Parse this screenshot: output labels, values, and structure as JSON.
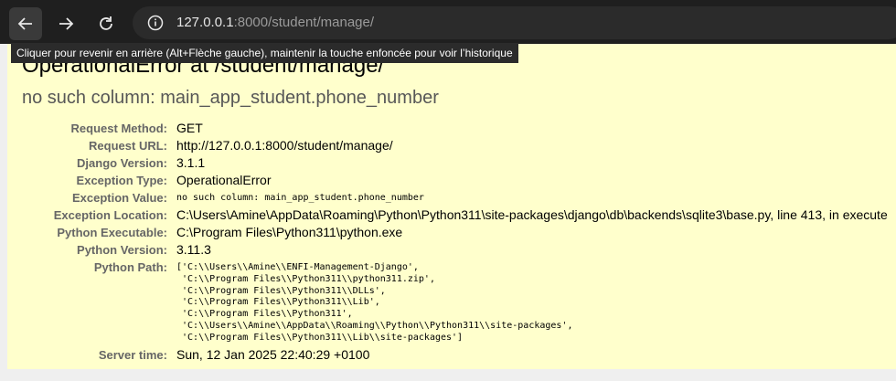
{
  "browser": {
    "url_host": "127.0.0.1",
    "url_rest": ":8000/student/manage/",
    "tooltip": "Cliquer pour revenir en arrière (Alt+Flèche gauche), maintenir la touche enfoncée pour voir l’historique"
  },
  "error": {
    "title": "OperationalError at /student/manage/",
    "message": "no such column: main_app_student.phone_number"
  },
  "meta": [
    {
      "label": "Request Method:",
      "value": "GET"
    },
    {
      "label": "Request URL:",
      "value": "http://127.0.0.1:8000/student/manage/"
    },
    {
      "label": "Django Version:",
      "value": "3.1.1"
    },
    {
      "label": "Exception Type:",
      "value": "OperationalError"
    },
    {
      "label": "Exception Value:",
      "value": "no such column: main_app_student.phone_number"
    },
    {
      "label": "Exception Location:",
      "value": "C:\\Users\\Amine\\AppData\\Roaming\\Python\\Python311\\site-packages\\django\\db\\backends\\sqlite3\\base.py, line 413, in execute"
    },
    {
      "label": "Python Executable:",
      "value": "C:\\Program Files\\Python311\\python.exe"
    },
    {
      "label": "Python Version:",
      "value": "3.11.3"
    },
    {
      "label": "Python Path:",
      "value": "['C:\\\\Users\\\\Amine\\\\ENFI-Management-Django',\n 'C:\\\\Program Files\\\\Python311\\\\python311.zip',\n 'C:\\\\Program Files\\\\Python311\\\\DLLs',\n 'C:\\\\Program Files\\\\Python311\\\\Lib',\n 'C:\\\\Program Files\\\\Python311',\n 'C:\\\\Users\\\\Amine\\\\AppData\\\\Roaming\\\\Python\\\\Python311\\\\site-packages',\n 'C:\\\\Program Files\\\\Python311\\\\Lib\\\\site-packages']"
    },
    {
      "label": "Server time:",
      "value": "Sun, 12 Jan 2025 22:40:29 +0100"
    }
  ]
}
